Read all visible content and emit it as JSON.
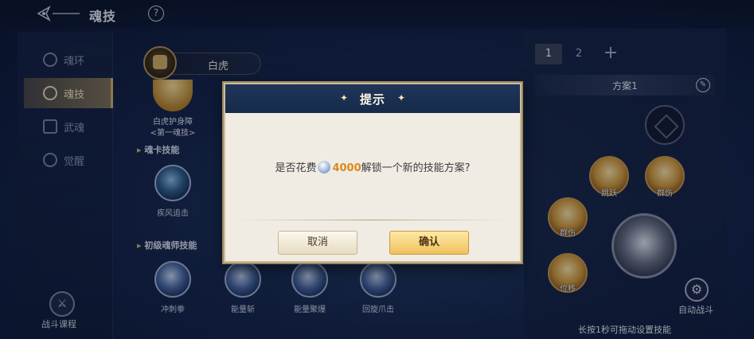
{
  "header": {
    "title": "魂技",
    "help_glyph": "?"
  },
  "sidebar": {
    "items": [
      {
        "label": "魂环",
        "active": false
      },
      {
        "label": "魂技",
        "active": true
      },
      {
        "label": "武魂",
        "active": false
      },
      {
        "label": "觉醒",
        "active": false
      }
    ],
    "footer_label": "战斗课程"
  },
  "soul": {
    "name": "白虎",
    "top_skill_name": "白虎护身障",
    "top_skill_sub": "<第一魂技>"
  },
  "sections": {
    "card_skills_title": "魂卡技能",
    "card_skill": "疾风追击",
    "basic_skills_title": "初级魂师技能",
    "basic_skills": [
      "冲刺拳",
      "能量斩",
      "能量聚爆",
      "回旋爪击"
    ]
  },
  "right_panel": {
    "tabs": [
      "1",
      "2",
      "+"
    ],
    "plan_name": "方案1",
    "slots": [
      "跳跃",
      "群伤",
      "群伤",
      "位移"
    ],
    "auto_battle_label": "自动战斗",
    "hint": "长按1秒可拖动设置技能"
  },
  "dialog": {
    "title": "提示",
    "message_prefix": "是否花费",
    "cost": "4000",
    "message_suffix": "解锁一个新的技能方案?",
    "cancel_label": "取消",
    "confirm_label": "确认"
  }
}
